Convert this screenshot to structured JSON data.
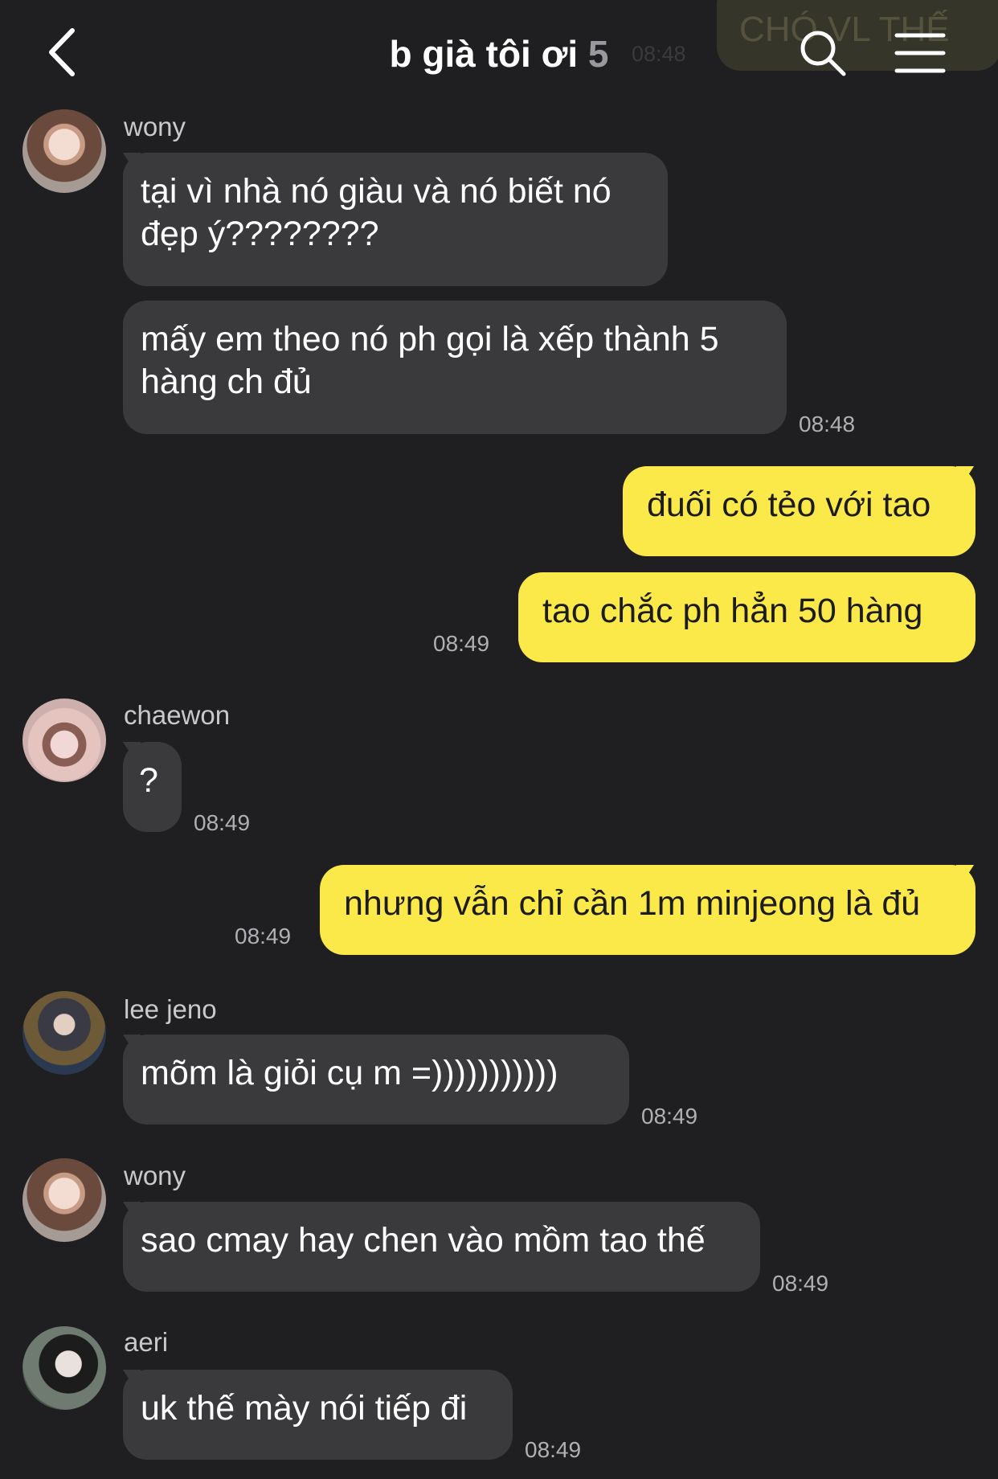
{
  "header": {
    "title": "b già tôi ơi",
    "member_count": "5",
    "back_icon": "chevron-left-icon",
    "search_icon": "search-icon",
    "menu_icon": "hamburger-menu-icon"
  },
  "ghost": {
    "bubble_text": "CHÓ VL THẾ",
    "time": "08:48"
  },
  "colors": {
    "background": "#1f1f21",
    "incoming_bubble": "#3a3a3c",
    "outgoing_bubble": "#fbe94a"
  },
  "messages": [
    {
      "sender": "wony",
      "text": "tại vì nhà nó giàu và nó biết nó\nđẹp ý????????"
    },
    {
      "text": "mấy em theo nó ph gọi là xếp thành 5\nhàng ch đủ",
      "time": "08:48"
    },
    {
      "text": "đuối có tẻo với tao"
    },
    {
      "text": "tao chắc ph hẳn 50 hàng",
      "time": "08:49"
    },
    {
      "sender": "chaewon",
      "text": "?",
      "time": "08:49"
    },
    {
      "text": "nhưng vẫn chỉ cần 1m minjeong là đủ",
      "time": "08:49"
    },
    {
      "sender": "lee jeno",
      "text": "mõm là giỏi cụ m =)))))))))))",
      "time": "08:49"
    },
    {
      "sender": "wony",
      "text": "sao cmay hay chen vào mồm tao thế",
      "time": "08:49"
    },
    {
      "sender": "aeri",
      "text": "uk thế mày nói tiếp đi",
      "time": "08:49"
    }
  ]
}
